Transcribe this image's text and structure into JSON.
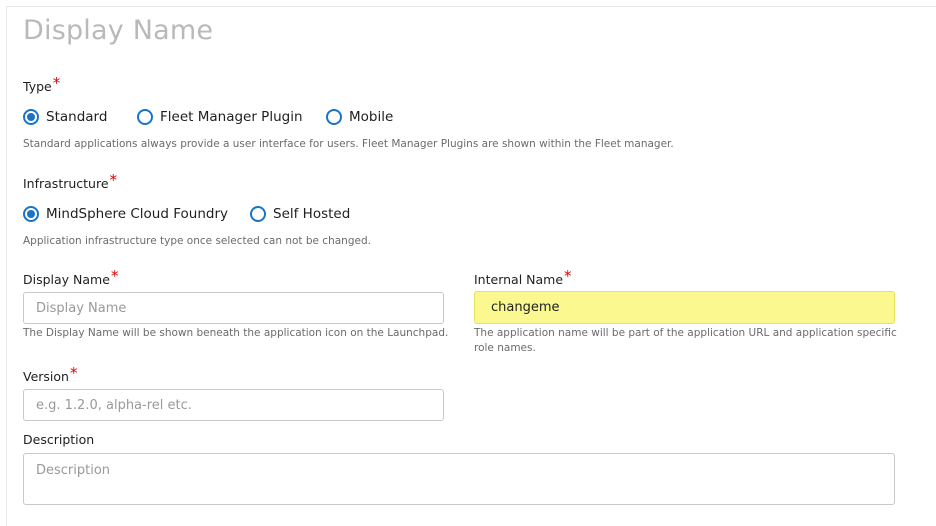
{
  "page": {
    "title": "Display Name"
  },
  "type_section": {
    "label": "Type",
    "required_mark": "*",
    "options": [
      {
        "label": "Standard",
        "selected": true
      },
      {
        "label": "Fleet Manager Plugin",
        "selected": false
      },
      {
        "label": "Mobile",
        "selected": false
      }
    ],
    "hint": "Standard applications always provide a user interface for users. Fleet Manager Plugins are shown within the Fleet manager."
  },
  "infrastructure_section": {
    "label": "Infrastructure",
    "required_mark": "*",
    "options": [
      {
        "label": "MindSphere Cloud Foundry",
        "selected": true
      },
      {
        "label": "Self Hosted",
        "selected": false
      }
    ],
    "hint": "Application infrastructure type once selected can not be changed."
  },
  "display_name_field": {
    "label": "Display Name",
    "required_mark": "*",
    "value": "",
    "placeholder": "Display Name",
    "hint": "The Display Name will be shown beneath the application icon on the Launchpad."
  },
  "internal_name_field": {
    "label": "Internal Name",
    "required_mark": "*",
    "value": "changeme",
    "hint": "The application name will be part of the application URL and application specific role names."
  },
  "version_field": {
    "label": "Version",
    "required_mark": "*",
    "value": "",
    "placeholder": "e.g. 1.2.0, alpha-rel etc."
  },
  "description_field": {
    "label": "Description",
    "value": "",
    "placeholder": "Description"
  },
  "colors": {
    "accent": "#1a73c8",
    "required": "#dc0000",
    "highlight": "#fbf88f"
  }
}
